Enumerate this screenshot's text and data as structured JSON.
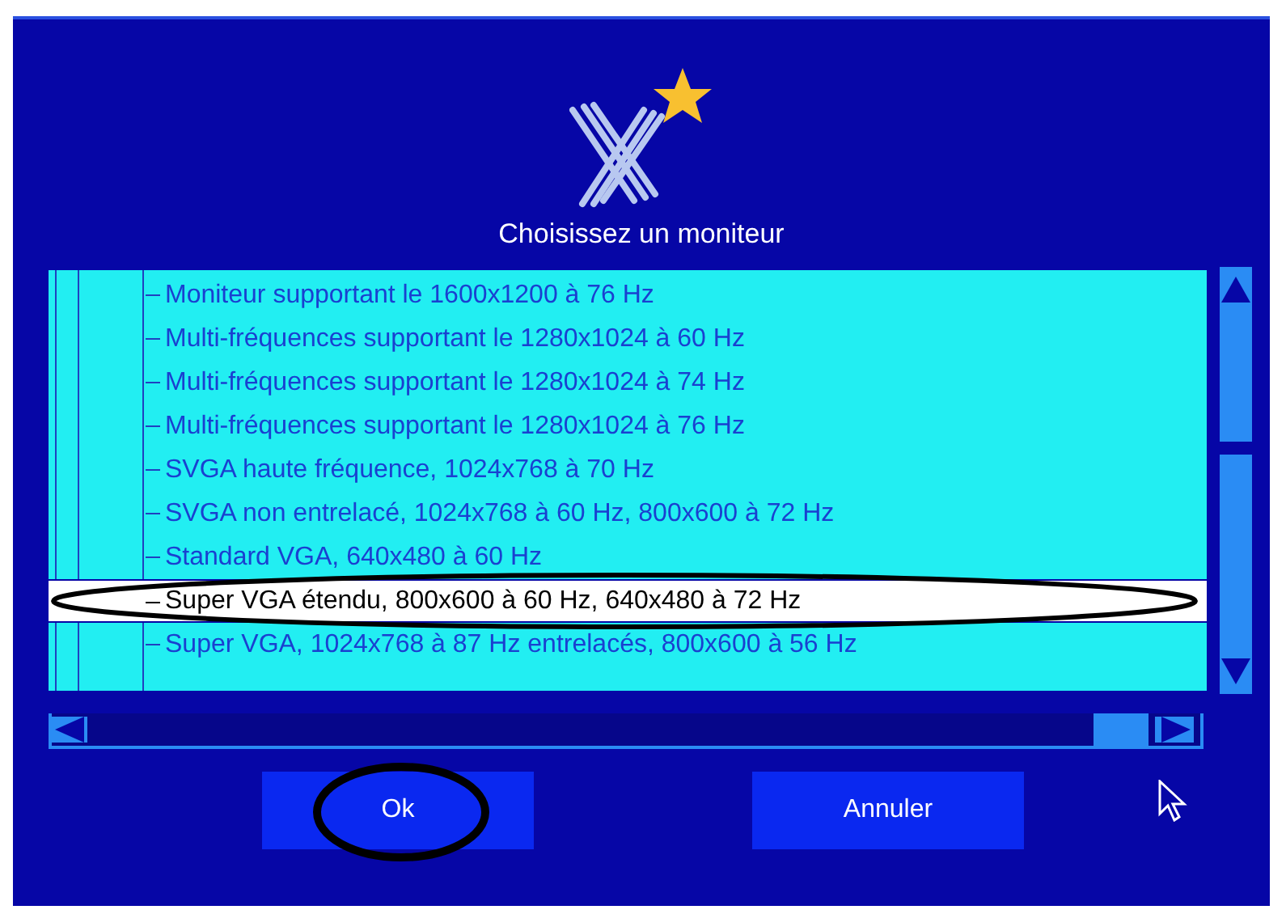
{
  "dialog": {
    "title": "Choisissez un moniteur"
  },
  "monitor_list": {
    "items": [
      {
        "label": "Moniteur supportant le 1600x1200 à 76 Hz",
        "selected": false
      },
      {
        "label": "Multi-fréquences supportant le 1280x1024 à 60 Hz",
        "selected": false
      },
      {
        "label": "Multi-fréquences supportant le 1280x1024 à 74 Hz",
        "selected": false
      },
      {
        "label": "Multi-fréquences supportant le 1280x1024 à 76 Hz",
        "selected": false
      },
      {
        "label": "SVGA haute fréquence, 1024x768 à 70 Hz",
        "selected": false
      },
      {
        "label": "SVGA non entrelacé, 1024x768 à 60 Hz, 800x600 à 72 Hz",
        "selected": false
      },
      {
        "label": "Standard VGA, 640x480 à 60 Hz",
        "selected": false
      },
      {
        "label": "Super VGA étendu, 800x600 à 60 Hz, 640x480 à 72 Hz",
        "selected": true
      },
      {
        "label": "Super VGA, 1024x768 à 87 Hz entrelacés, 800x600 à 56 Hz",
        "selected": false
      }
    ]
  },
  "buttons": [
    {
      "label": "Ok",
      "circled": true
    },
    {
      "label": "Annuler",
      "circled": false
    }
  ]
}
